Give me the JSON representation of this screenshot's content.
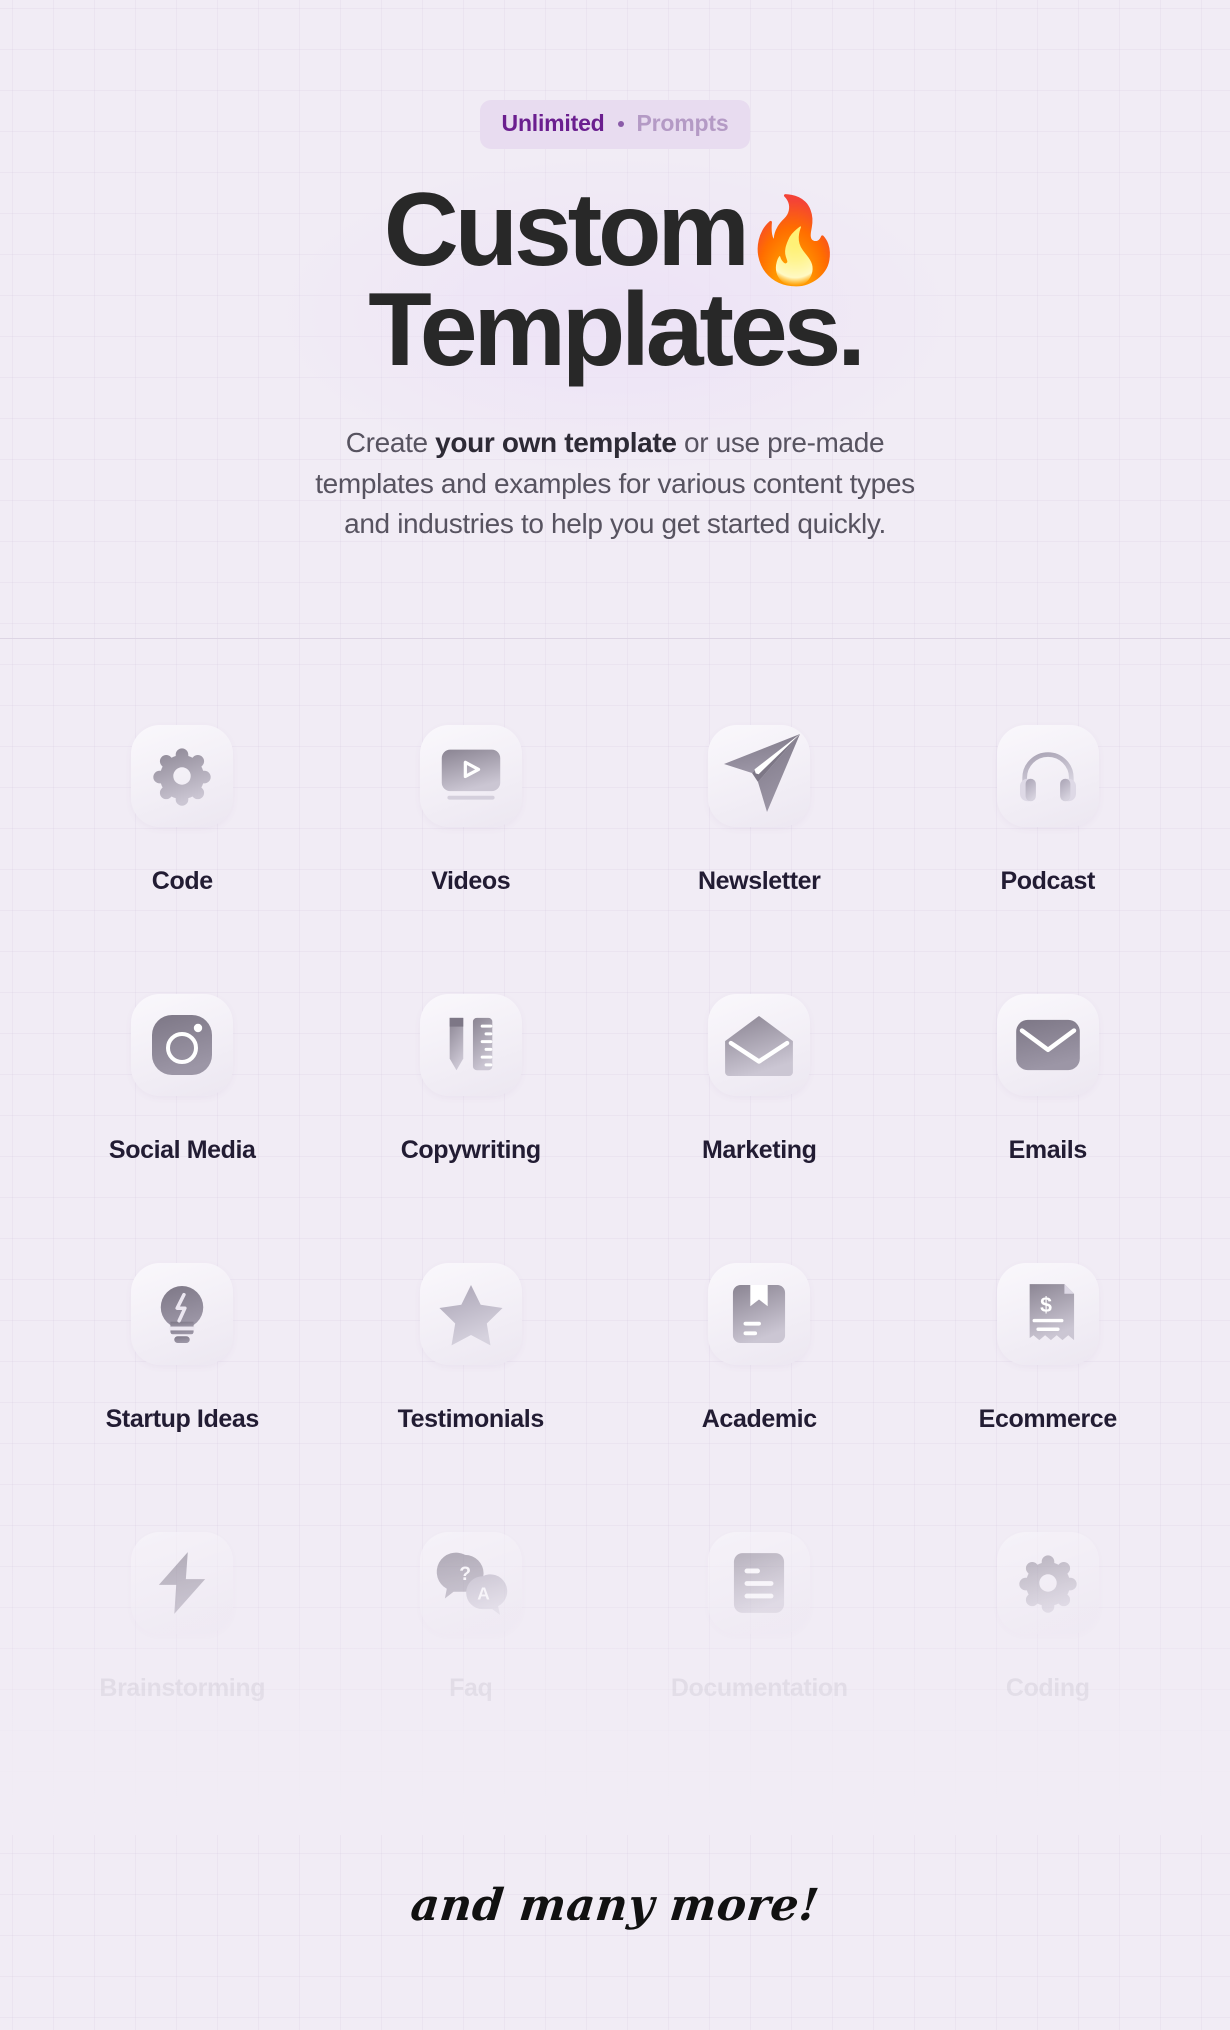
{
  "theme": {
    "background": "#f1ecf5",
    "badge_bg": "#e8dcf0",
    "badge_strong_color": "#6b1f8f",
    "badge_muted_color": "#b49ac5",
    "headline_color": "#282828",
    "subtitle_color": "#575360",
    "label_color": "#221c33",
    "tile_gradient_from": "#faf8fc",
    "tile_gradient_to": "#ece7f1",
    "icon_gradient_from": "#8d8795",
    "icon_gradient_to": "#c9c4d2",
    "divider_color": "#ddd5e4"
  },
  "badge": {
    "strong": "Unlimited",
    "separator": "•",
    "muted": "Prompts"
  },
  "headline": {
    "line1": "Custom",
    "emoji": "🔥",
    "line2": "Templates."
  },
  "subtitle": {
    "part1": "Create ",
    "bold": "your own template",
    "part2": " or use pre-made templates and examples for various content types and industries to help you get started quickly."
  },
  "grid": {
    "rows": [
      {
        "faded": false,
        "cells": [
          {
            "label": "Code",
            "icon": "gear-icon"
          },
          {
            "label": "Videos",
            "icon": "video-play-icon"
          },
          {
            "label": "Newsletter",
            "icon": "paper-plane-icon"
          },
          {
            "label": "Podcast",
            "icon": "headphones-icon"
          }
        ]
      },
      {
        "faded": false,
        "cells": [
          {
            "label": "Social Media",
            "icon": "camera-icon"
          },
          {
            "label": "Copywriting",
            "icon": "pencil-ruler-icon"
          },
          {
            "label": "Marketing",
            "icon": "open-envelope-icon"
          },
          {
            "label": "Emails",
            "icon": "envelope-icon"
          }
        ]
      },
      {
        "faded": false,
        "cells": [
          {
            "label": "Startup Ideas",
            "icon": "lightbulb-icon"
          },
          {
            "label": "Testimonials",
            "icon": "star-icon"
          },
          {
            "label": "Academic",
            "icon": "bookmark-book-icon"
          },
          {
            "label": "Ecommerce",
            "icon": "receipt-icon"
          }
        ]
      },
      {
        "faded": true,
        "cells": [
          {
            "label": "Brainstorming",
            "icon": "lightning-bolt-icon"
          },
          {
            "label": "Faq",
            "icon": "question-answer-bubbles-icon"
          },
          {
            "label": "Documentation",
            "icon": "document-icon"
          },
          {
            "label": "Coding",
            "icon": "gear-icon"
          }
        ]
      }
    ]
  },
  "footer": {
    "text": "and many more!"
  }
}
